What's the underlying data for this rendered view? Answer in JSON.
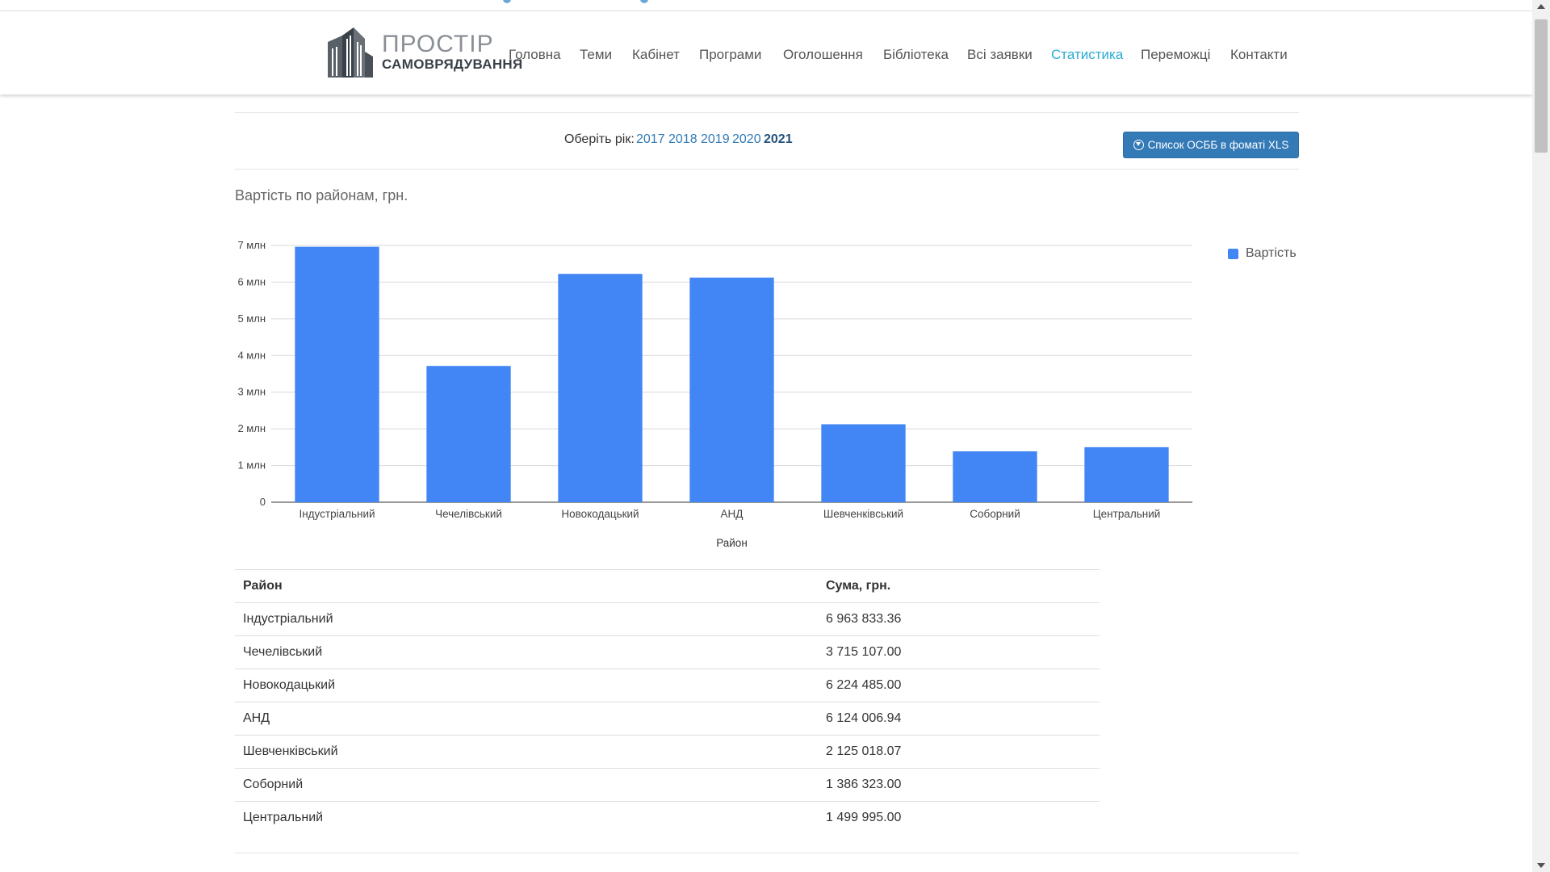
{
  "header": {
    "logo_line1": "ПРОСТІР",
    "logo_line2": "САМОВРЯДУВАННЯ",
    "nav": [
      {
        "label": "Головна",
        "active": false
      },
      {
        "label": "Теми",
        "active": false
      },
      {
        "label": "Кабінет",
        "active": false
      },
      {
        "label": "Програми",
        "active": false
      },
      {
        "label": "Оголошення",
        "active": false
      },
      {
        "label": "Бібліотека",
        "active": false
      },
      {
        "label": "Всі заявки",
        "active": false
      },
      {
        "label": "Статистика",
        "active": true
      },
      {
        "label": "Переможці",
        "active": false
      },
      {
        "label": "Контакти",
        "active": false
      }
    ]
  },
  "year_selector": {
    "label": "Оберіть рік:",
    "years": [
      "2017",
      "2018",
      "2019",
      "2020",
      "2021"
    ],
    "selected": "2021"
  },
  "xls_button": {
    "label": "Список ОСББ в фоматі XLS",
    "icon": "download-circle-icon"
  },
  "chart_title": "Вартість по районам, грн.",
  "chart_data": {
    "type": "bar",
    "categories": [
      "Індустріальний",
      "Чечелівський",
      "Новокодацький",
      "АНД",
      "Шевченківський",
      "Соборний",
      "Центральний"
    ],
    "series": [
      {
        "name": "Вартість",
        "values": [
          6963833.36,
          3715107.0,
          6224485.0,
          6124006.94,
          2125018.07,
          1386323.0,
          1499995.0
        ]
      }
    ],
    "xlabel": "Район",
    "ylabel": "",
    "ylim": [
      0,
      7000000
    ],
    "yticks": [
      0,
      1000000,
      2000000,
      3000000,
      4000000,
      5000000,
      6000000,
      7000000
    ],
    "ytick_labels": [
      "0",
      "1 млн",
      "2 млн",
      "3 млн",
      "4 млн",
      "5 млн",
      "6 млн",
      "7 млн"
    ],
    "grid": true,
    "legend_position": "right",
    "color": "#4285f4"
  },
  "table": {
    "headers": [
      "Район",
      "Сума, грн."
    ],
    "rows": [
      [
        "Індустріальний",
        "6 963 833.36"
      ],
      [
        "Чечелівський",
        "3 715 107.00"
      ],
      [
        "Новокодацький",
        "6 224 485.00"
      ],
      [
        "АНД",
        "6 124 006.94"
      ],
      [
        "Шевченківський",
        "2 125 018.07"
      ],
      [
        "Соборний",
        "1 386 323.00"
      ],
      [
        "Центральний",
        "1 499 995.00"
      ]
    ]
  }
}
